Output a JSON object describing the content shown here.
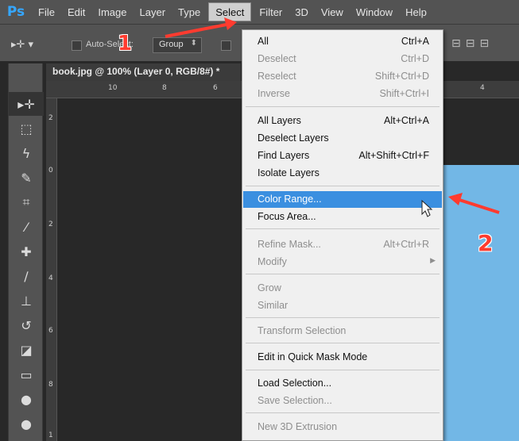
{
  "app": {
    "logo": "Ps",
    "menu": [
      "File",
      "Edit",
      "Image",
      "Layer",
      "Type",
      "Select",
      "Filter",
      "3D",
      "View",
      "Window",
      "Help"
    ],
    "active_menu": "Select"
  },
  "options_bar": {
    "tool_glyph": "▸✛ ▾",
    "autoselect_label": "Auto-Select:",
    "autoselect_value": "Group",
    "align_glyphs": "⊟⊟⊟"
  },
  "document": {
    "tab_title": "book.jpg @ 100% (Layer 0, RGB/8#) *",
    "ruler_top": [
      "10",
      "8",
      "6",
      "4"
    ],
    "ruler_left": [
      "2",
      "0",
      "2",
      "4",
      "6",
      "8",
      "1"
    ]
  },
  "tools": [
    {
      "name": "move-tool-icon",
      "glyph": "▸✛"
    },
    {
      "name": "marquee-tool-icon",
      "glyph": "⬚"
    },
    {
      "name": "lasso-tool-icon",
      "glyph": "ϟ"
    },
    {
      "name": "quick-selection-tool-icon",
      "glyph": "✎"
    },
    {
      "name": "crop-tool-icon",
      "glyph": "⌗"
    },
    {
      "name": "eyedropper-tool-icon",
      "glyph": "⁄"
    },
    {
      "name": "healing-brush-tool-icon",
      "glyph": "✚"
    },
    {
      "name": "brush-tool-icon",
      "glyph": "∕"
    },
    {
      "name": "clone-stamp-tool-icon",
      "glyph": "⊥"
    },
    {
      "name": "history-brush-tool-icon",
      "glyph": "↺"
    },
    {
      "name": "eraser-tool-icon",
      "glyph": "◪"
    },
    {
      "name": "gradient-tool-icon",
      "glyph": "▭"
    },
    {
      "name": "blur-tool-icon",
      "glyph": "●"
    },
    {
      "name": "dodge-tool-icon",
      "glyph": "●"
    }
  ],
  "select_menu": {
    "items": [
      {
        "label": "All",
        "shortcut": "Ctrl+A",
        "disabled": false
      },
      {
        "label": "Deselect",
        "shortcut": "Ctrl+D",
        "disabled": true
      },
      {
        "label": "Reselect",
        "shortcut": "Shift+Ctrl+D",
        "disabled": true
      },
      {
        "label": "Inverse",
        "shortcut": "Shift+Ctrl+I",
        "disabled": true
      },
      {
        "label": "All Layers",
        "shortcut": "Alt+Ctrl+A",
        "disabled": false
      },
      {
        "label": "Deselect Layers",
        "shortcut": "",
        "disabled": false
      },
      {
        "label": "Find Layers",
        "shortcut": "Alt+Shift+Ctrl+F",
        "disabled": false
      },
      {
        "label": "Isolate Layers",
        "shortcut": "",
        "disabled": false
      },
      {
        "label": "Color Range...",
        "shortcut": "",
        "disabled": false,
        "highlighted": true
      },
      {
        "label": "Focus Area...",
        "shortcut": "",
        "disabled": false
      },
      {
        "label": "Refine Mask...",
        "shortcut": "Alt+Ctrl+R",
        "disabled": true
      },
      {
        "label": "Modify",
        "shortcut": "",
        "disabled": true,
        "submenu": true
      },
      {
        "label": "Grow",
        "shortcut": "",
        "disabled": true
      },
      {
        "label": "Similar",
        "shortcut": "",
        "disabled": true
      },
      {
        "label": "Transform Selection",
        "shortcut": "",
        "disabled": true
      },
      {
        "label": "Edit in Quick Mask Mode",
        "shortcut": "",
        "disabled": false
      },
      {
        "label": "Load Selection...",
        "shortcut": "",
        "disabled": false
      },
      {
        "label": "Save Selection...",
        "shortcut": "",
        "disabled": true
      },
      {
        "label": "New 3D Extrusion",
        "shortcut": "",
        "disabled": true
      }
    ],
    "submenu_arrow": "▶"
  },
  "annotations": {
    "step1": "1",
    "step2": "2",
    "color": "#ff3b2f"
  },
  "colors": {
    "highlight": "#3b8fe0",
    "canvas_blue": "#72b7e6"
  }
}
